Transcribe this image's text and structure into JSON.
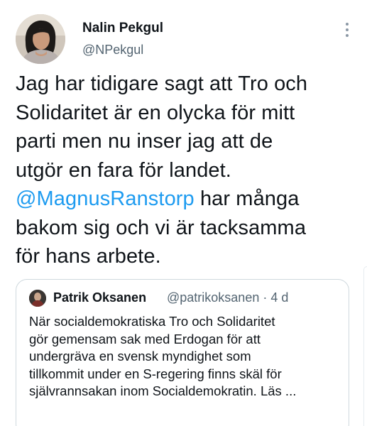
{
  "author": {
    "display_name": "Nalin Pekgul",
    "handle": "@NPekgul"
  },
  "tweet": {
    "line1": "Jag har tidigare sagt att Tro och",
    "line2": "Solidaritet är en olycka för mitt",
    "line3": "parti men nu inser jag att de",
    "line4": "utgör en fara för landet.",
    "mention": "@MagnusRanstorp",
    "line5_rest": " har många",
    "line6": "bakom sig och vi är tacksamma",
    "line7": "för hans arbete."
  },
  "quoted_tweet": {
    "display_name": "Patrik Oksanen",
    "handle": "@patrikoksanen",
    "time": "· 4 d",
    "line1": "När socialdemokratiska Tro och Solidaritet",
    "line2": "gör gemensam sak med Erdogan för att",
    "line3": "undergräva en svensk myndighet som",
    "line4": "tillkommit under en S-regering finns skäl för",
    "line5": "självrannsakan inom Socialdemokratin. Läs ..."
  },
  "colors": {
    "text": "#0f1419",
    "secondary_text": "#536471",
    "link": "#1d9bf0",
    "border": "#cfd9de"
  },
  "icons": {
    "more": "more-vertical-icon"
  }
}
